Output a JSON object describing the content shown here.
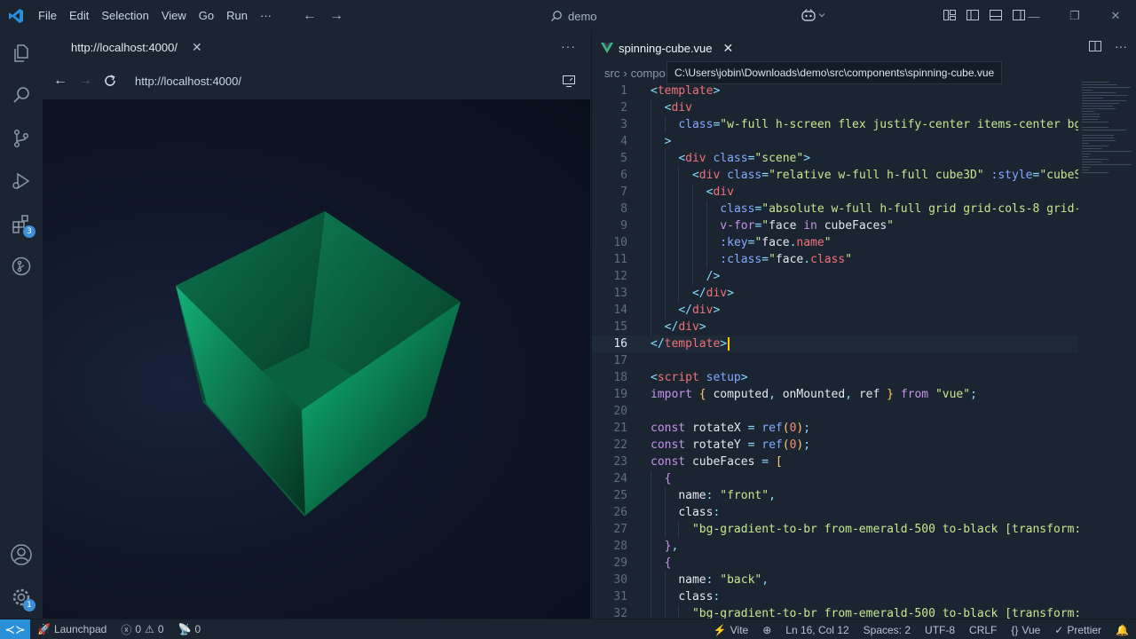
{
  "menu": [
    "File",
    "Edit",
    "Selection",
    "View",
    "Go",
    "Run",
    "···"
  ],
  "command_center": "demo",
  "browser": {
    "tab_title": "http://localhost:4000/",
    "url": "http://localhost:4000/"
  },
  "editor": {
    "tab_title": "spinning-cube.vue",
    "breadcrumb": [
      "src",
      "compo"
    ],
    "tooltip": "C:\\Users\\jobin\\Downloads\\demo\\src\\components\\spinning-cube.vue",
    "active_line": 16
  },
  "activity": {
    "extensions_badge": "3",
    "accounts_badge": "1"
  },
  "status": {
    "launchpad": "Launchpad",
    "errors": "0",
    "warnings": "0",
    "ports": "0",
    "vite": "Vite",
    "position": "Ln 16, Col 12",
    "spaces": "Spaces: 2",
    "encoding": "UTF-8",
    "eol": "CRLF",
    "language": "Vue",
    "formatter": "Prettier"
  },
  "colors": {
    "background": "#1b2532",
    "accent": "#2a8fd9",
    "cube": "#12a36e"
  }
}
